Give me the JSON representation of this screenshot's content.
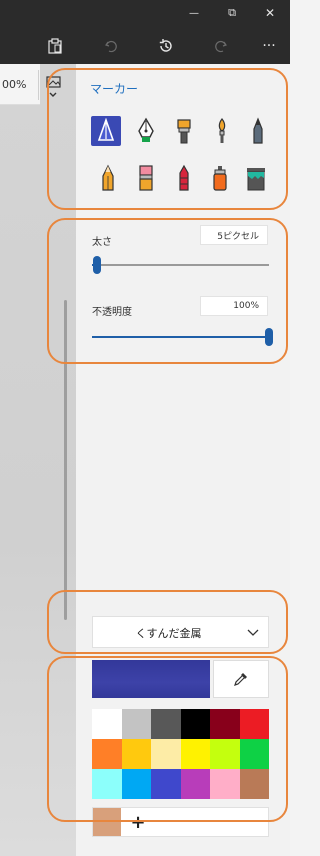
{
  "window": {
    "minimize": "—",
    "restore": "⧉",
    "close": "✕"
  },
  "commands": {
    "more": "···"
  },
  "canvas": {
    "zoom": "00%"
  },
  "brushes": {
    "title": "マーカー",
    "tools": [
      {
        "name": "calligraphy-pen",
        "selected": true
      },
      {
        "name": "fountain-pen"
      },
      {
        "name": "oil-brush"
      },
      {
        "name": "watercolor-brush"
      },
      {
        "name": "pencil-fine"
      },
      {
        "name": "pencil"
      },
      {
        "name": "eraser"
      },
      {
        "name": "crayon"
      },
      {
        "name": "spray-can"
      },
      {
        "name": "pixel-pen"
      }
    ]
  },
  "thickness": {
    "label": "太さ",
    "value_text": "5ピクセル",
    "level": 0.03
  },
  "opacity": {
    "label": "不透明度",
    "value_text": "100%",
    "level": 1.0
  },
  "texture": {
    "selected": "くすんだ金属"
  },
  "colors": {
    "current": "#33389a",
    "palette": [
      "#ffffff",
      "#c3c3c3",
      "#585858",
      "#000000",
      "#88001b",
      "#ec1c24",
      "#ff7f27",
      "#ffc90e",
      "#fdeca6",
      "#fff200",
      "#c4ff0e",
      "#0ed145",
      "#8cfffb",
      "#00a8f3",
      "#3f48cc",
      "#b83dba",
      "#ffaec8",
      "#b97a57"
    ],
    "custom": "#d8a07b",
    "add_label": "+"
  }
}
